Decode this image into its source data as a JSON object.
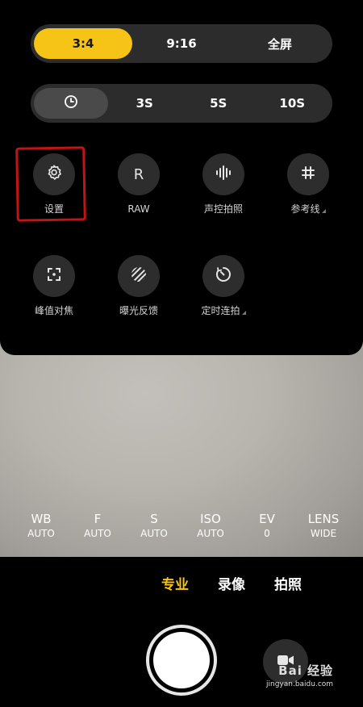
{
  "aspect_ratio": {
    "options": [
      "3:4",
      "9:16",
      "全屏"
    ],
    "selected": "3:4"
  },
  "timer": {
    "options": [
      "3S",
      "5S",
      "10S"
    ],
    "selected_icon": "clock-icon"
  },
  "options_row1": [
    {
      "label": "设置",
      "icon": "gear-icon"
    },
    {
      "label": "RAW",
      "icon_text": "R"
    },
    {
      "label": "声控拍照",
      "icon": "soundwave-icon"
    },
    {
      "label": "参考线",
      "icon": "grid-hash-icon"
    }
  ],
  "options_row2": [
    {
      "label": "峰值对焦",
      "icon": "focus-peaking-icon"
    },
    {
      "label": "曝光反馈",
      "icon": "zebra-stripes-icon"
    },
    {
      "label": "定时连拍",
      "icon": "interval-timer-icon"
    }
  ],
  "pro_params": [
    {
      "name": "WB",
      "value": "AUTO"
    },
    {
      "name": "F",
      "value": "AUTO"
    },
    {
      "name": "S",
      "value": "AUTO"
    },
    {
      "name": "ISO",
      "value": "AUTO"
    },
    {
      "name": "EV",
      "value": "0"
    },
    {
      "name": "LENS",
      "value": "WIDE"
    }
  ],
  "modes": {
    "items": [
      "专业",
      "录像",
      "拍照"
    ],
    "active": "专业"
  },
  "watermark": {
    "brand": "Bai 经验",
    "url": "jingyan.baidu.com"
  },
  "colors": {
    "accent": "#f5c416",
    "highlight": "#c21414"
  }
}
